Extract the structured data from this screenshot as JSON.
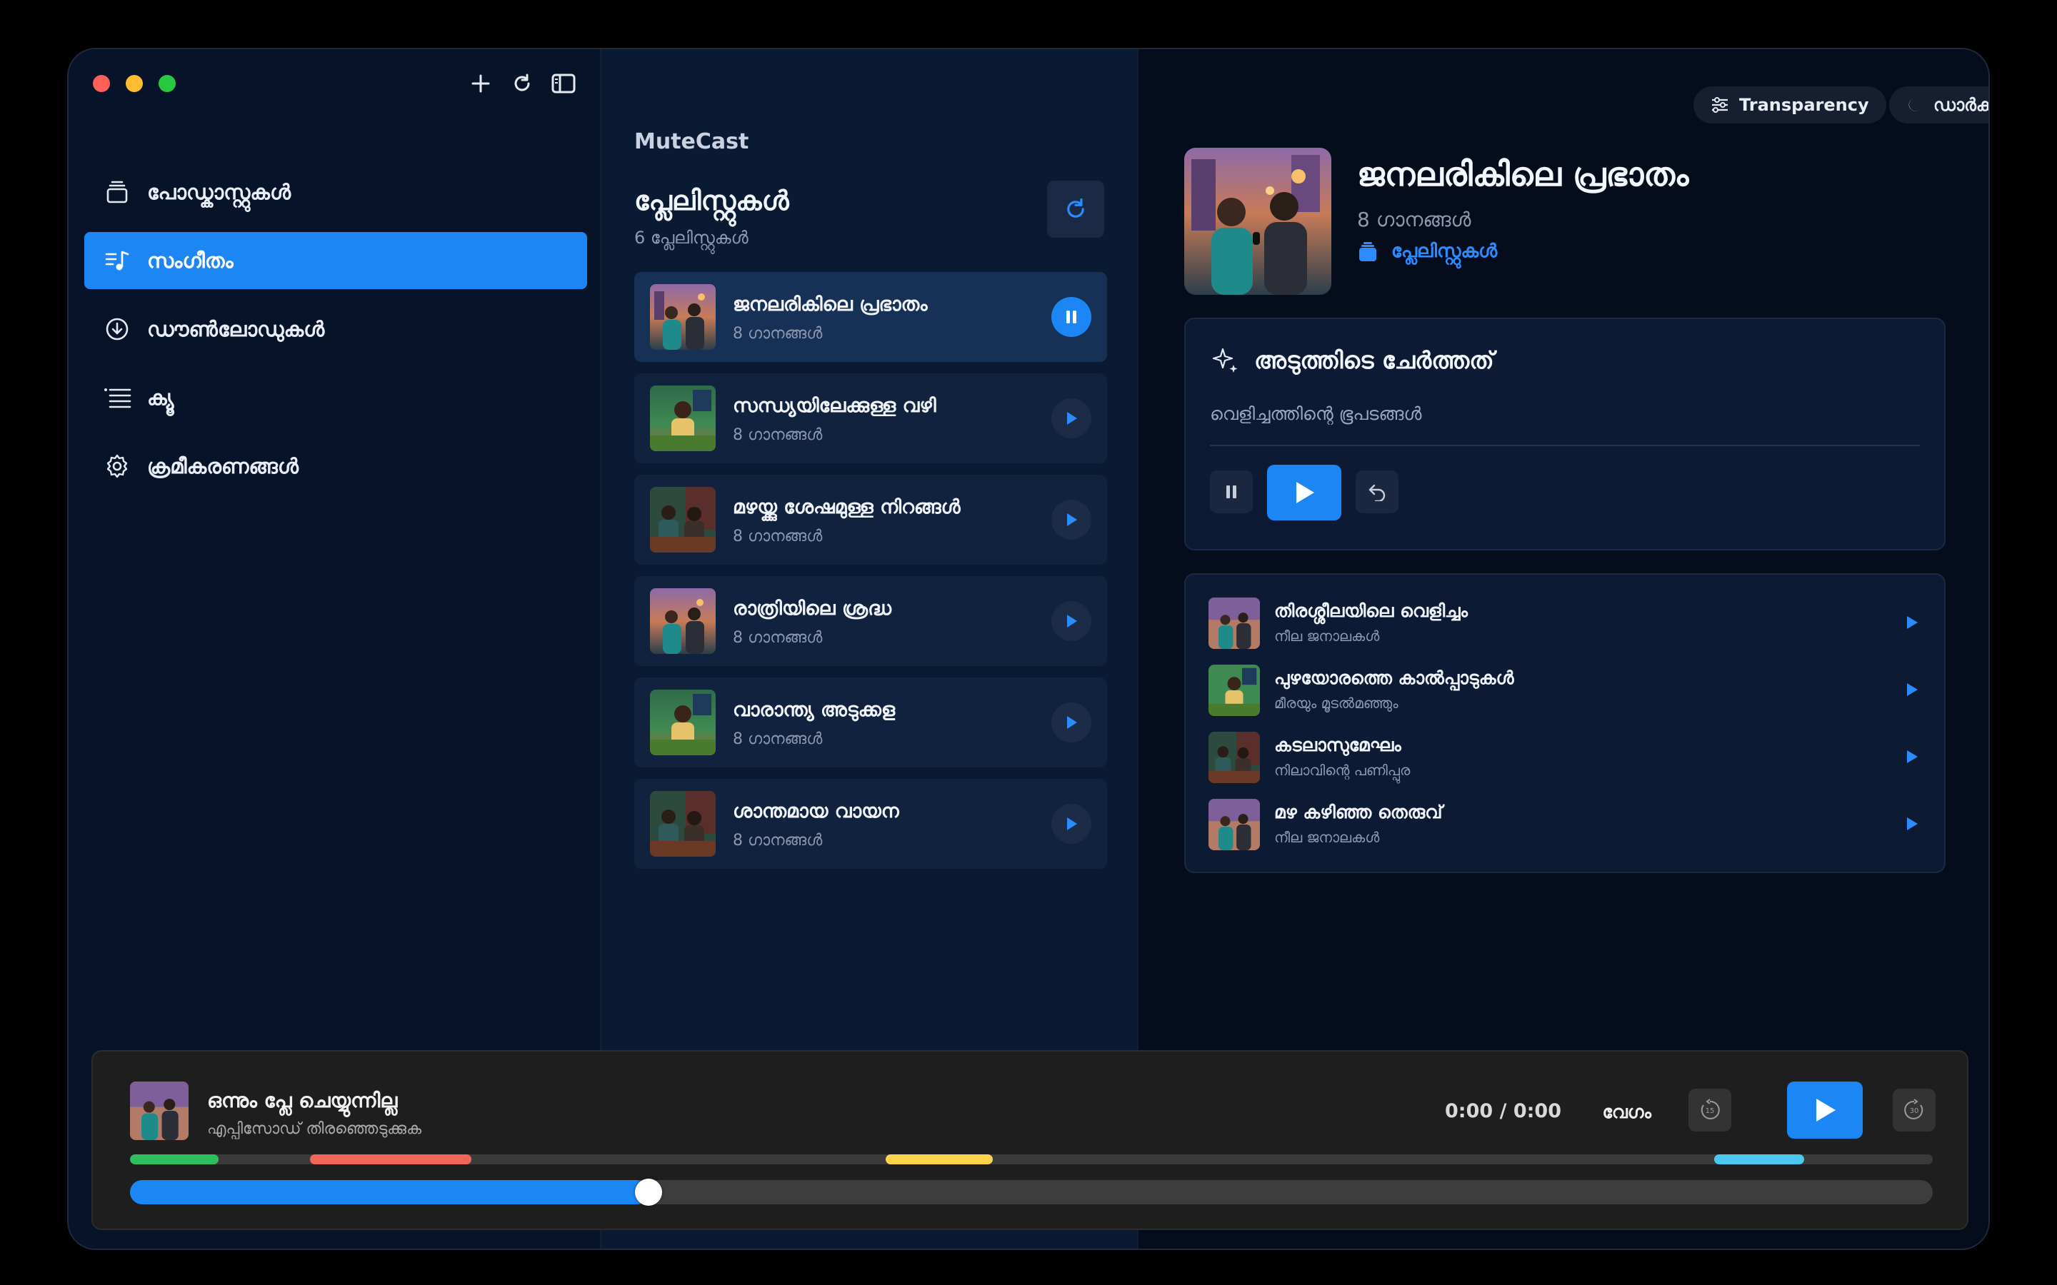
{
  "colors": {
    "accent": "#1c86f5",
    "chapter_green": "#2ebf61",
    "chapter_red": "#f0675a",
    "chapter_yellow": "#fcd34a",
    "chapter_cyan": "#4cc7f0"
  },
  "toolbar": {
    "icons": [
      "plus-icon",
      "refresh-icon",
      "sidebar-toggle-icon"
    ]
  },
  "sidebar": {
    "items": [
      {
        "label": "പോഡ്കാസ്റ്റുകൾ",
        "icon": "podcast-stack-icon",
        "active": false
      },
      {
        "label": "സംഗീതം",
        "icon": "music-note-icon",
        "active": true
      },
      {
        "label": "ഡൗൺലോഡുകൾ",
        "icon": "download-circle-icon",
        "active": false
      },
      {
        "label": "ക്യൂ",
        "icon": "queue-list-icon",
        "active": false
      },
      {
        "label": "ക്രമീകരണങ്ങൾ",
        "icon": "gear-icon",
        "active": false
      }
    ]
  },
  "middle": {
    "brand": "MuteCast",
    "title": "പ്ലേലിസ്റ്റുകൾ",
    "subtitle": "6 പ്ലേലിസ്റ്റുകൾ",
    "playlists": [
      {
        "name": "ജനലരികിലെ പ്രഭാതം",
        "count": "8 ഗാനങ്ങൾ",
        "playing": true
      },
      {
        "name": "സന്ധ്യയിലേക്കുള്ള വഴി",
        "count": "8 ഗാനങ്ങൾ",
        "playing": false
      },
      {
        "name": "മഴയ്ക്കു ശേഷമുള്ള നിറങ്ങൾ",
        "count": "8 ഗാനങ്ങൾ",
        "playing": false
      },
      {
        "name": "രാത്രിയിലെ ശ്രദ്ധ",
        "count": "8 ഗാനങ്ങൾ",
        "playing": false
      },
      {
        "name": "വാരാന്ത്യ അടുക്കള",
        "count": "8 ഗാനങ്ങൾ",
        "playing": false
      },
      {
        "name": "ശാന്തമായ വായന",
        "count": "8 ഗാനങ്ങൾ",
        "playing": false
      }
    ]
  },
  "right": {
    "transparency_label": "Transparency",
    "theme_label": "ഡാർക്ക്",
    "title": "ജനലരികിലെ പ്രഭാതം",
    "count": "8 ഗാനങ്ങൾ",
    "link": "പ്ലേലിസ്റ്റുകൾ",
    "recent": {
      "heading": "അടുത്തിടെ ചേർത്തത്",
      "subtitle": "വെളിച്ചത്തിന്റെ ഭൂപടങ്ങൾ"
    },
    "tracks": [
      {
        "title": "തിരശ്ശീലയിലെ വെളിച്ചം",
        "artist": "നീല ജനാലകൾ"
      },
      {
        "title": "പുഴയോരത്തെ കാൽപ്പാടുകൾ",
        "artist": "മീരയും മൂടൽമഞ്ഞും"
      },
      {
        "title": "കടലാസുമേഘം",
        "artist": "നിലാവിന്റെ പണിപ്പുര"
      },
      {
        "title": "മഴ കഴിഞ്ഞ തെരുവ്",
        "artist": "നീല ജനാലകൾ"
      }
    ]
  },
  "player": {
    "title": "ഒന്നും പ്ലേ ചെയ്യുന്നില്ല",
    "subtitle": "എപ്പിസോഡ് തിരഞ്ഞെടുക്കുക",
    "time": "0:00 / 0:00",
    "speed_label": "വേഗം",
    "skip_back": "15",
    "skip_forward": "30",
    "progress": 0.28
  }
}
